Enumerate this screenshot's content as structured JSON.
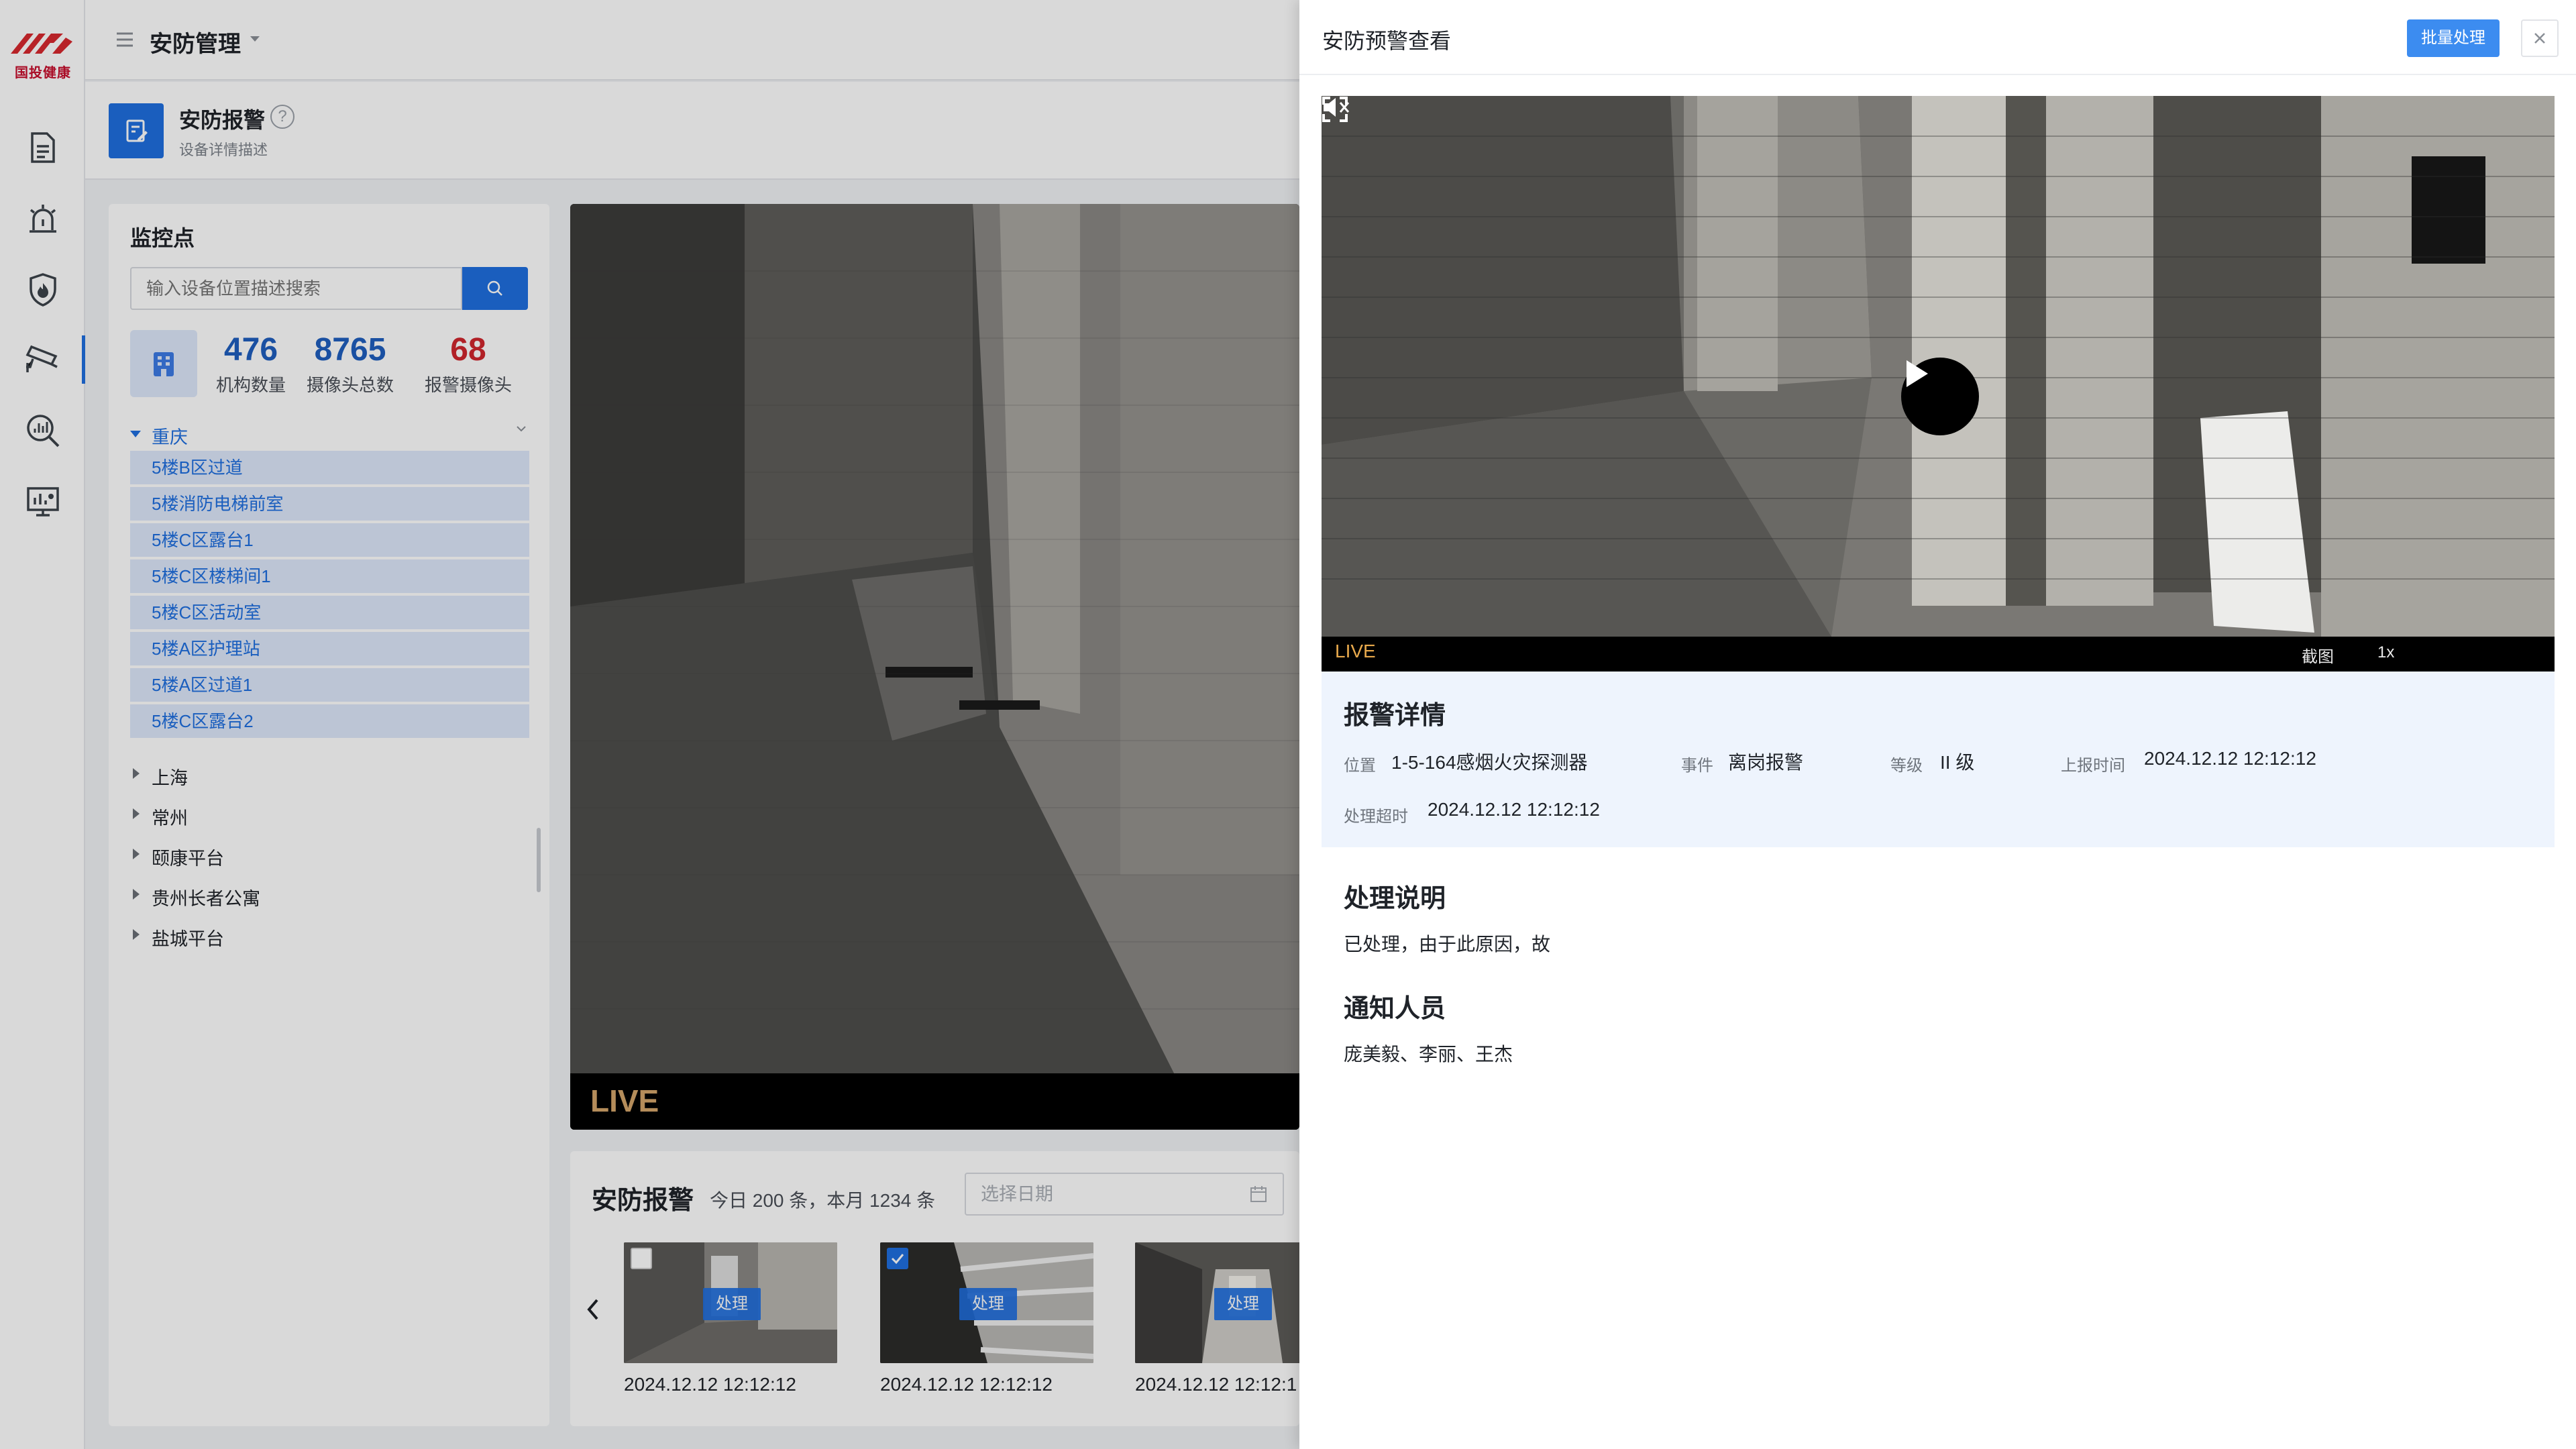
{
  "brand": {
    "logo_text": "国投健康",
    "accent": "#1f6fe0",
    "danger": "#d0262d"
  },
  "header": {
    "module_title": "安防管理"
  },
  "rail": {
    "icons": [
      "document-icon",
      "alarm-bell-icon",
      "fire-shield-icon",
      "cctv-camera-icon",
      "search-chart-icon",
      "monitor-chart-icon"
    ],
    "active": "cctv-camera-icon"
  },
  "page": {
    "title": "安防报警",
    "subtitle": "设备详情描述"
  },
  "monitor": {
    "title": "监控点",
    "search_placeholder": "输入设备位置描述搜索",
    "stats": [
      {
        "value": "476",
        "label": "机构数量"
      },
      {
        "value": "8765",
        "label": "摄像头总数"
      },
      {
        "value": "68",
        "label": "报警摄像头"
      }
    ],
    "group": {
      "name": "重庆",
      "items": [
        "5楼B区过道",
        "5楼消防电梯前室",
        "5楼C区露台1",
        "5楼C区楼梯间1",
        "5楼C区活动室",
        "5楼A区护理站",
        "5楼A区过道1",
        "5楼C区露台2"
      ]
    },
    "regions": [
      "上海",
      "常州",
      "颐康平台",
      "贵州长者公寓",
      "盐城平台"
    ]
  },
  "feed": {
    "live_label": "LIVE"
  },
  "alarm": {
    "title": "安防报警",
    "count_text": "今日 200 条，本月 1234 条",
    "date_placeholder": "选择日期",
    "thumbs": [
      {
        "time": "2024.12.12  12:12:12",
        "action": "处理",
        "checked": false
      },
      {
        "time": "2024.12.12  12:12:12",
        "action": "处理",
        "checked": true
      },
      {
        "time": "2024.12.12  12:12:1",
        "action": "处理",
        "checked": false
      }
    ]
  },
  "drawer": {
    "title": "安防预警查看",
    "batch_button": "批量处理",
    "player": {
      "live": "LIVE",
      "screenshot": "截图",
      "speed": "1x"
    },
    "detail": {
      "title": "报警详情",
      "location_label": "位置",
      "location": "1-5-164感烟火灾探测器",
      "event_label": "事件",
      "event": "离岗报警",
      "level_label": "等级",
      "level": "II 级",
      "report_label": "上报时间",
      "report_time": "2024.12.12 12:12:12",
      "timeout_label": "处理超时",
      "timeout_time": "2024.12.12 12:12:12"
    },
    "handling": {
      "title": "处理说明",
      "text": "已处理，由于此原因，故"
    },
    "notify": {
      "title": "通知人员",
      "people": "庞美毅、李丽、王杰"
    }
  }
}
